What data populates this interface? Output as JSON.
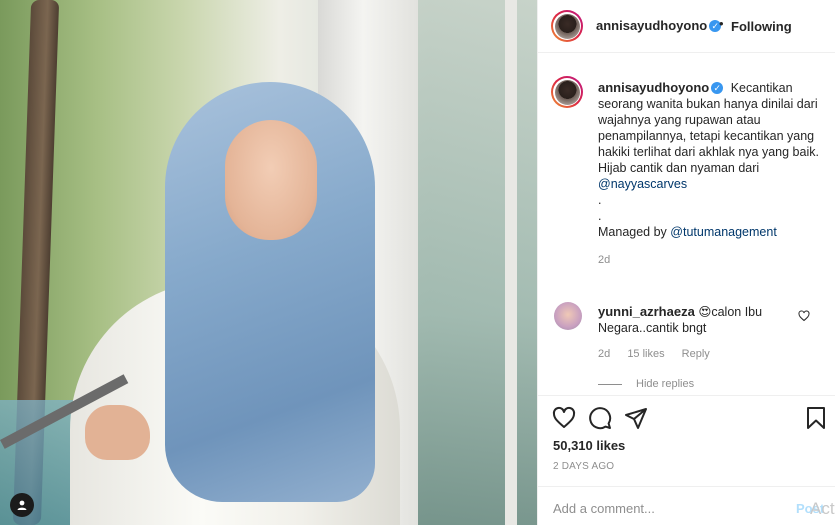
{
  "post": {
    "username": "annisayudhoyono",
    "follow_separator": "•",
    "follow_label": "Following"
  },
  "caption": {
    "username": "annisayudhoyono",
    "text": "Kecantikan seorang wanita bukan hanya dinilai dari wajahnya yang rupawan atau penampilannya, tetapi kecantikan yang hakiki terlihat dari akhlak nya yang baik.",
    "line2": "Hijab cantik dan nyaman dari",
    "mention1": "@nayyascarves",
    "dot1": ".",
    "dot2": ".",
    "managed_prefix": "Managed by",
    "mention2": "@tutumanagement",
    "age": "2d"
  },
  "comment": {
    "username": "yunni_azrhaeza",
    "emoji": "😍",
    "text": "calon Ibu Negara..cantik bngt",
    "age": "2d",
    "likes": "15 likes",
    "reply": "Reply",
    "hide_replies": "Hide replies"
  },
  "actions": {
    "likes": "50,310 likes",
    "date": "2 DAYS AGO",
    "comment_placeholder": "Add a comment...",
    "post_label": "Post",
    "watermark": "Act"
  },
  "icons": {
    "verified": "verified-badge-icon",
    "like": "heart-icon",
    "comment": "comment-icon",
    "share": "paper-plane-icon",
    "save": "bookmark-icon",
    "tag": "user-tag-icon"
  },
  "colors": {
    "link": "#00376b",
    "verified": "#3897f0",
    "muted": "#8e8e8e",
    "post_disabled": "#b2dffc"
  }
}
